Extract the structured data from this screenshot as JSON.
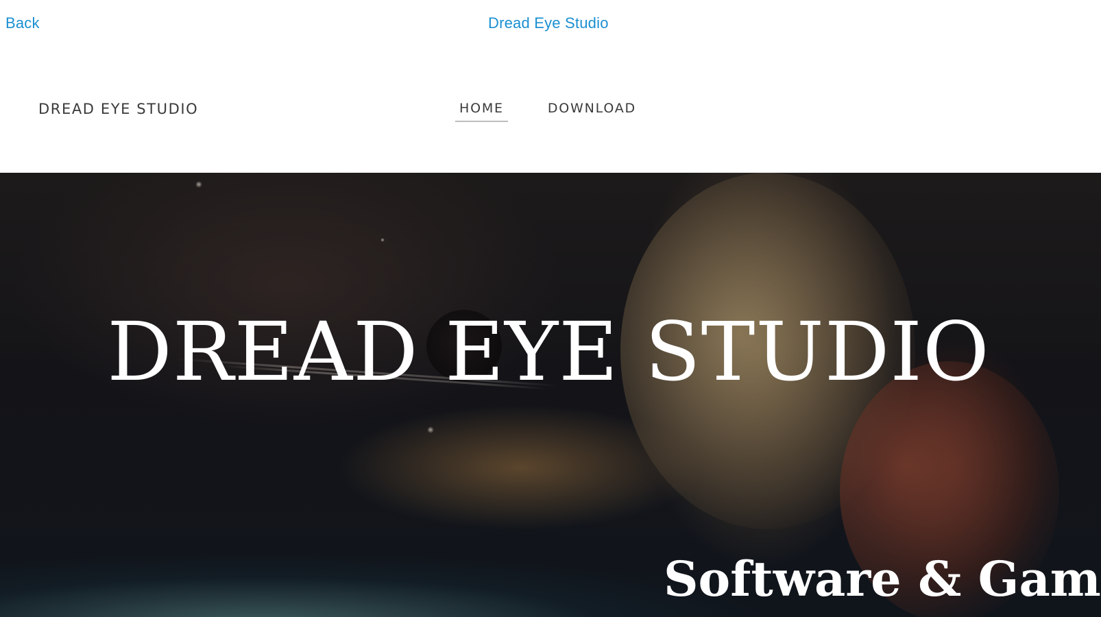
{
  "topbar": {
    "back_label": "Back",
    "title": "Dread Eye Studio"
  },
  "header": {
    "logo_text": "DREAD EYE STUDIO",
    "nav": [
      {
        "label": "HOME",
        "active": true
      },
      {
        "label": "DOWNLOAD",
        "active": false
      }
    ]
  },
  "hero": {
    "title": "DREAD EYE STUDIO",
    "subtitle": "Software & Game"
  },
  "colors": {
    "link": "#1a8fd1",
    "nav_text": "#3a3a3a",
    "hero_text": "#ffffff"
  }
}
